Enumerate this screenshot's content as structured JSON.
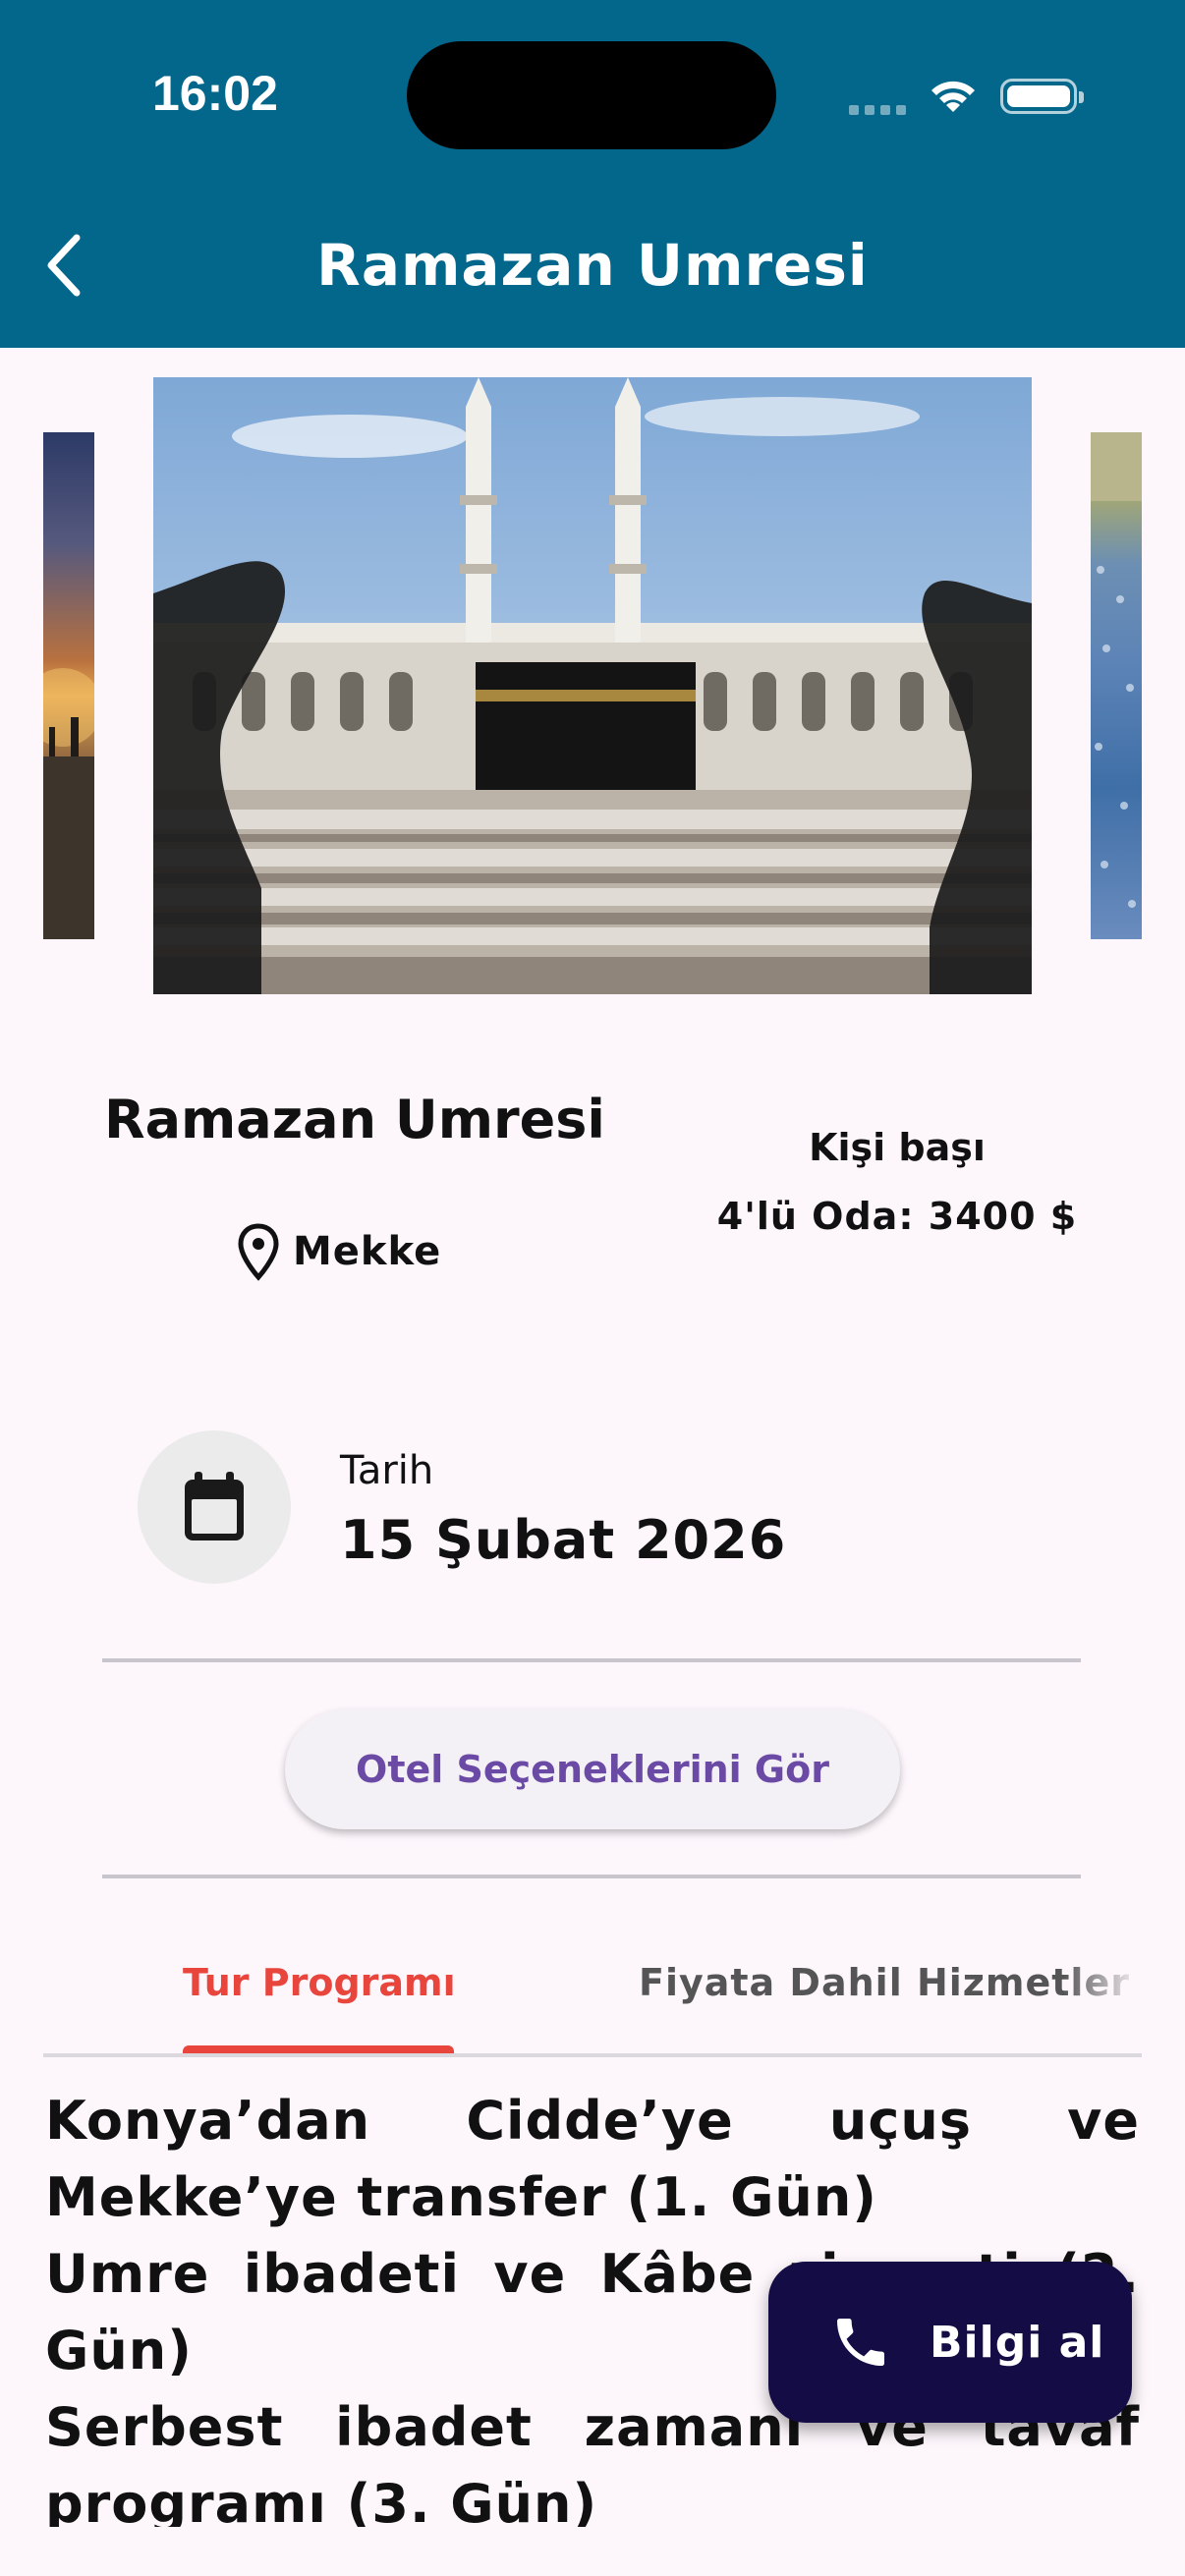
{
  "status_bar": {
    "time": "16:02"
  },
  "header": {
    "title": "Ramazan Umresi",
    "back_icon": "chevron-left-icon"
  },
  "colors": {
    "header_bg": "#03668b",
    "tab_active": "#e8453c",
    "button_text": "#6a4aa4",
    "fab_bg": "#140c44"
  },
  "carousel": {
    "images": [
      "sunset-city-photo",
      "kaaba-mecca-photo",
      "crowd-photo"
    ]
  },
  "tour": {
    "name": "Ramazan Umresi",
    "location": "Mekke",
    "price_label": "Kişi başı",
    "price_value": "4'lü Oda: 3400 $"
  },
  "date": {
    "label": "Tarih",
    "value": "15 Şubat 2026"
  },
  "hotel_button": {
    "label": "Otel Seçeneklerini Gör"
  },
  "tabs": [
    {
      "label": "Tur Programı",
      "active": true
    },
    {
      "label": "Fiyata Dahil Hizmetler",
      "active": false
    }
  ],
  "program": [
    "Konya’dan Cidde’ye uçuş ve Mekke’ye transfer (1. Gün)",
    "Umre ibadeti ve Kâbe ziyareti (2. Gün)",
    "Serbest ibadet zamanı ve tavaf programı (3. Gün)"
  ],
  "fab": {
    "label": "Bilgi al",
    "icon": "phone-icon"
  }
}
